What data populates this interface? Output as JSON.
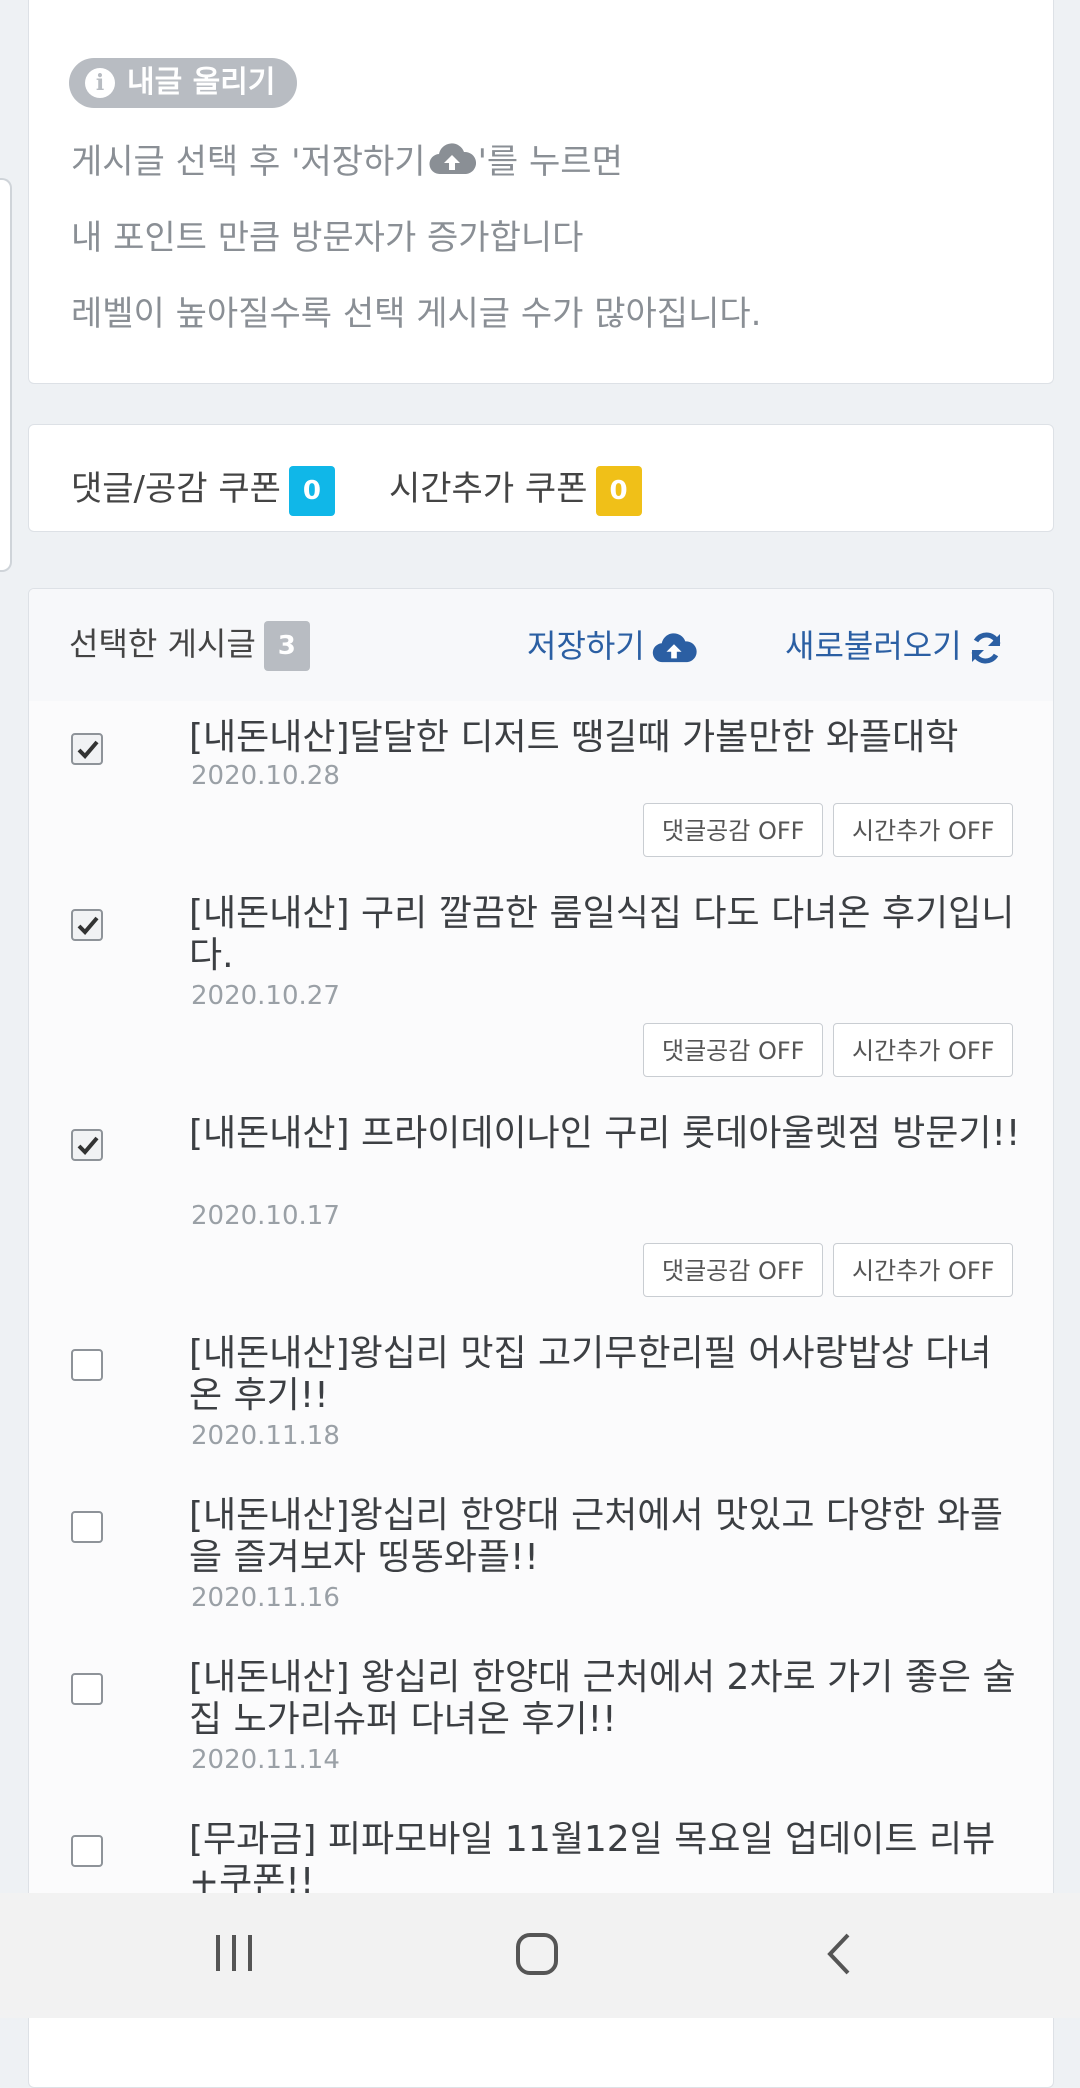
{
  "info": {
    "pill_label": "내글 올리기",
    "pill_icon": "info-icon",
    "line1_before": "게시글 선택 후 '저장하기",
    "line1_after": "'를 누르면",
    "line2": "내 포인트 만큼 방문자가 증가합니다",
    "line3": "레벨이 높아질수록 선택 게시글 수가 많아집니다."
  },
  "coupons": {
    "comment_like_label": "댓글/공감 쿠폰",
    "comment_like_count": "0",
    "comment_like_color": "#10b7e8",
    "time_add_label": "시간추가 쿠폰",
    "time_add_count": "0",
    "time_add_color": "#f0c018"
  },
  "list": {
    "header_title": "선택한 게시글",
    "selected_count": "3",
    "save_label": "저장하기",
    "refresh_label": "새로불러오기",
    "comment_btn": "댓글공감 OFF",
    "time_btn": "시간추가 OFF",
    "posts": [
      {
        "title": "[내돈내산]달달한 디저트 땡길때 가볼만한 와플대학",
        "date": "2020.10.28",
        "checked": true
      },
      {
        "title": "[내돈내산] 구리 깔끔한 룸일식집 다도 다녀온 후기입니다.",
        "date": "2020.10.27",
        "checked": true
      },
      {
        "title": "[내돈내산] 프라이데이나인 구리 롯데아울렛점 방문기!!",
        "date": "2020.10.17",
        "checked": true
      },
      {
        "title": "[내돈내산]왕십리 맛집 고기무한리필 어사랑밥상 다녀온 후기!!",
        "date": "2020.11.18",
        "checked": false
      },
      {
        "title": "[내돈내산]왕십리 한양대 근처에서 맛있고 다양한 와플을 즐겨보자 띵똥와플!!",
        "date": "2020.11.16",
        "checked": false
      },
      {
        "title": "[내돈내산] 왕십리 한양대 근처에서 2차로 가기 좋은 술집 노가리슈퍼 다녀온 후기!!",
        "date": "2020.11.14",
        "checked": false
      },
      {
        "title": "[무과금] 피파모바일 11월12일 목요일 업데이트 리뷰+쿠폰!!",
        "date": "",
        "checked": false
      }
    ]
  },
  "navbar": {
    "recent_icon": "recent-apps-icon",
    "home_icon": "home-icon",
    "back_icon": "back-icon"
  }
}
